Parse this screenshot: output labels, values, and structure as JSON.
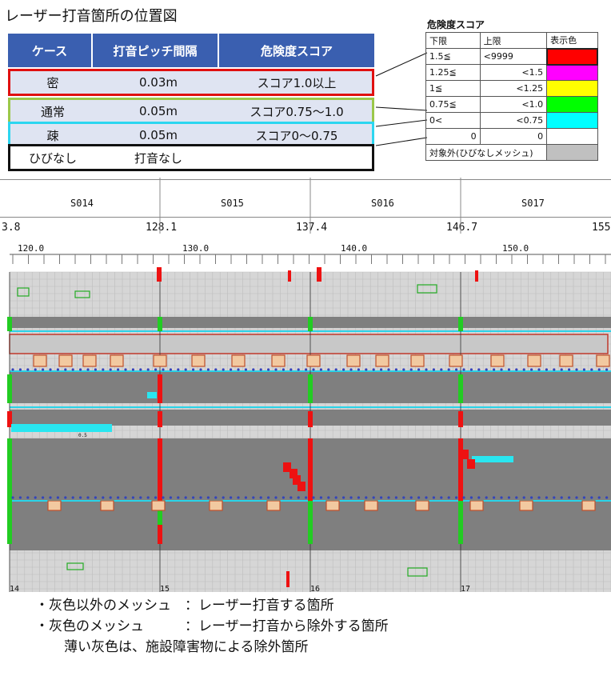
{
  "title": "レーザー打音箇所の位置図",
  "pitch_table": {
    "headers": [
      "ケース",
      "打音ピッチ間隔",
      "危険度スコア"
    ],
    "rows": [
      {
        "case": "密",
        "pitch": "0.03m",
        "score": "スコア1.0以上",
        "border": "#e01010"
      },
      {
        "case": "通常",
        "pitch": "0.05m",
        "score": "スコア0.75～1.0",
        "border": "#9bc84a"
      },
      {
        "case": "疎",
        "pitch": "0.05m",
        "score": "スコア0～0.75",
        "border": "#2cd6f0"
      },
      {
        "case": "ひびなし",
        "pitch": "打音なし",
        "score": "",
        "border": "#111111"
      }
    ],
    "header_color": "#3a5fb0"
  },
  "score_table": {
    "title": "危険度スコア",
    "headers": [
      "下限",
      "上限",
      "表示色"
    ],
    "rows": [
      {
        "lower": "1.5≦",
        "upper": "<9999",
        "color": "#ff0000"
      },
      {
        "lower": "1.25≦",
        "upper": "<1.5",
        "color": "#ff00ff"
      },
      {
        "lower": "1≦",
        "upper": "<1.25",
        "color": "#ffff00"
      },
      {
        "lower": "0.75≦",
        "upper": "<1.0",
        "color": "#00ff00"
      },
      {
        "lower": "0<",
        "upper": "<0.75",
        "color": "#00ffff"
      },
      {
        "lower": "0",
        "upper": "0",
        "color": "#ffffff"
      }
    ],
    "excluded_label": "対象外(ひびなしメッシュ)",
    "excluded_color": "#c0c0c0"
  },
  "stations": {
    "segments": [
      "S014",
      "S015",
      "S016",
      "S017"
    ],
    "boundaries": [
      "3.8",
      "128.1",
      "137.4",
      "146.7",
      "155"
    ],
    "scale_ticks": [
      "120.0",
      "130.0",
      "140.0",
      "150.0"
    ],
    "span_numbers": [
      "14",
      "15",
      "16",
      "17"
    ],
    "small_labels": [
      "0.5",
      "0.5"
    ]
  },
  "notes": {
    "line1": "・灰色以外のメッシュ　：レーザー打音する箇所",
    "line2": "・灰色のメッシュ　　　：レーザー打音から除外する箇所",
    "line3": "薄い灰色は、施設障害物による除外箇所"
  }
}
